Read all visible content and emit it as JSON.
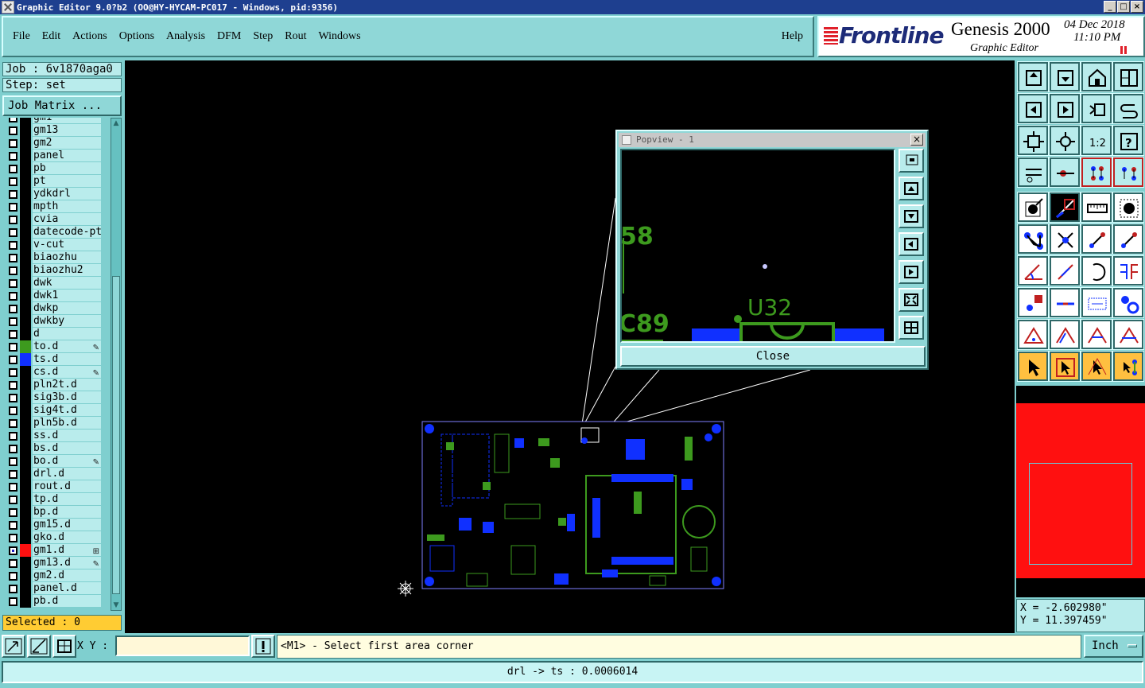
{
  "window": {
    "title": "Graphic Editor 9.0?b2 (OO@HY-HYCAM-PC017 - Windows, pid:9356)",
    "buttons": {
      "minimize": "_",
      "maximize": "□",
      "close": "×"
    }
  },
  "menu": {
    "items": [
      "File",
      "Edit",
      "Actions",
      "Options",
      "Analysis",
      "DFM",
      "Step",
      "Rout",
      "Windows"
    ],
    "help": "Help"
  },
  "logo": {
    "brand": "Frontline",
    "product": "Genesis 2000",
    "subtitle": "Graphic Editor",
    "date": "04 Dec 2018",
    "time": "11:10 PM"
  },
  "job": {
    "job_label": "Job : 6v1870aga0",
    "step_label": "Step: set",
    "matrix_button": "Job Matrix ..."
  },
  "layers": [
    {
      "name": "gm1",
      "color": "#000000",
      "mark": ""
    },
    {
      "name": "gm13",
      "color": "#000000",
      "mark": ""
    },
    {
      "name": "gm2",
      "color": "#000000",
      "mark": ""
    },
    {
      "name": "panel",
      "color": "#000000",
      "mark": ""
    },
    {
      "name": "pb",
      "color": "#000000",
      "mark": ""
    },
    {
      "name": "pt",
      "color": "#000000",
      "mark": ""
    },
    {
      "name": "ydkdrl",
      "color": "#000000",
      "mark": ""
    },
    {
      "name": "mpth",
      "color": "#000000",
      "mark": ""
    },
    {
      "name": "cvia",
      "color": "#000000",
      "mark": ""
    },
    {
      "name": "datecode-ptc",
      "color": "#000000",
      "mark": ""
    },
    {
      "name": "v-cut",
      "color": "#000000",
      "mark": ""
    },
    {
      "name": "biaozhu",
      "color": "#000000",
      "mark": ""
    },
    {
      "name": "biaozhu2",
      "color": "#000000",
      "mark": ""
    },
    {
      "name": "dwk",
      "color": "#000000",
      "mark": ""
    },
    {
      "name": "dwk1",
      "color": "#000000",
      "mark": ""
    },
    {
      "name": "dwkp",
      "color": "#000000",
      "mark": ""
    },
    {
      "name": "dwkby",
      "color": "#000000",
      "mark": ""
    },
    {
      "name": "d",
      "color": "#000000",
      "mark": ""
    },
    {
      "name": "to.d",
      "color": "#3d9a1e",
      "mark": "✎"
    },
    {
      "name": "ts.d",
      "color": "#1030ff",
      "mark": ""
    },
    {
      "name": "cs.d",
      "color": "#000000",
      "mark": "✎"
    },
    {
      "name": "pln2t.d",
      "color": "#000000",
      "mark": ""
    },
    {
      "name": "sig3b.d",
      "color": "#000000",
      "mark": ""
    },
    {
      "name": "sig4t.d",
      "color": "#000000",
      "mark": ""
    },
    {
      "name": "pln5b.d",
      "color": "#000000",
      "mark": ""
    },
    {
      "name": "ss.d",
      "color": "#000000",
      "mark": ""
    },
    {
      "name": "bs.d",
      "color": "#000000",
      "mark": ""
    },
    {
      "name": "bo.d",
      "color": "#000000",
      "mark": "✎"
    },
    {
      "name": "drl.d",
      "color": "#000000",
      "mark": ""
    },
    {
      "name": "rout.d",
      "color": "#000000",
      "mark": ""
    },
    {
      "name": "tp.d",
      "color": "#000000",
      "mark": ""
    },
    {
      "name": "bp.d",
      "color": "#000000",
      "mark": ""
    },
    {
      "name": "gm15.d",
      "color": "#000000",
      "mark": ""
    },
    {
      "name": "gko.d",
      "color": "#000000",
      "mark": ""
    },
    {
      "name": "gm1.d",
      "color": "#ff1010",
      "mark": "⊞"
    },
    {
      "name": "gm13.d",
      "color": "#000000",
      "mark": "✎"
    },
    {
      "name": "gm2.d",
      "color": "#000000",
      "mark": ""
    },
    {
      "name": "panel.d",
      "color": "#000000",
      "mark": ""
    },
    {
      "name": "pb.d",
      "color": "#000000",
      "mark": ""
    }
  ],
  "selected_label": "Selected : 0",
  "popview": {
    "title": "Popview - 1",
    "labels": [
      "58",
      "U32",
      "C89"
    ],
    "close_button": "Close"
  },
  "coords": {
    "x_label": "X = -2.602980\"",
    "y_label": "Y = 11.397459\""
  },
  "bottom": {
    "xy_label": "X Y :",
    "xy_value": "",
    "message": "<M1> - Select first area corner",
    "unit": "Inch",
    "status": "drl -> ts : 0.0006014"
  },
  "colors": {
    "panel": "#7fcfcf",
    "top_layer": "#3d9a1e",
    "solder_layer": "#1030ff",
    "minimap": "#ff1010",
    "selected_bg": "#ffcc33"
  }
}
